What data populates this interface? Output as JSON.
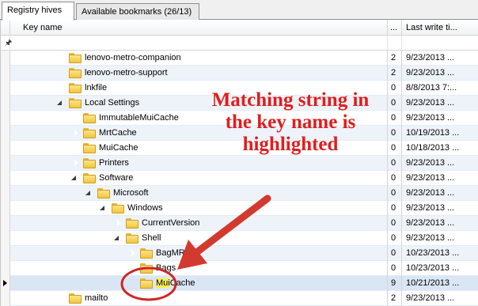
{
  "tabs": [
    {
      "label": "Registry hives",
      "active": true
    },
    {
      "label": "Available bookmarks (26/13)",
      "active": false
    }
  ],
  "columns": {
    "name": "Key name",
    "count": "...",
    "date": "Last write ti..."
  },
  "filter_icon": "pin-icon",
  "rows": [
    {
      "indent": 4,
      "expander": "none",
      "name": "lenovo-metro-companion",
      "count": "2",
      "date": "9/23/2013 ..."
    },
    {
      "indent": 4,
      "expander": "none",
      "name": "lenovo-metro-support",
      "count": "2",
      "date": "9/23/2013 ..."
    },
    {
      "indent": 4,
      "expander": "closed",
      "name": "lnkfile",
      "count": "0",
      "date": "8/8/2013 7:..."
    },
    {
      "indent": 4,
      "expander": "open",
      "name": "Local Settings",
      "count": "0",
      "date": "9/23/2013 ..."
    },
    {
      "indent": 5,
      "expander": "closed",
      "name": "ImmutableMuiCache",
      "count": "0",
      "date": "9/23/2013 ..."
    },
    {
      "indent": 5,
      "expander": "closed",
      "name": "MrtCache",
      "count": "0",
      "date": "10/19/2013 ..."
    },
    {
      "indent": 5,
      "expander": "closed",
      "name": "MuiCache",
      "count": "0",
      "date": "10/18/2013 ..."
    },
    {
      "indent": 5,
      "expander": "closed",
      "name": "Printers",
      "count": "0",
      "date": "9/23/2013 ..."
    },
    {
      "indent": 5,
      "expander": "open",
      "name": "Software",
      "count": "0",
      "date": "9/23/2013 ..."
    },
    {
      "indent": 6,
      "expander": "open",
      "name": "Microsoft",
      "count": "0",
      "date": "9/23/2013 ..."
    },
    {
      "indent": 7,
      "expander": "open",
      "name": "Windows",
      "count": "0",
      "date": "9/23/2013 ..."
    },
    {
      "indent": 8,
      "expander": "closed",
      "name": "CurrentVersion",
      "count": "0",
      "date": "9/23/2013 ..."
    },
    {
      "indent": 8,
      "expander": "open",
      "name": "Shell",
      "count": "0",
      "date": "9/23/2013 ..."
    },
    {
      "indent": 9,
      "expander": "closed",
      "name": "BagMRU",
      "count": "0",
      "date": "10/23/2013 ..."
    },
    {
      "indent": 9,
      "expander": "closed",
      "name": "Bags",
      "count": "0",
      "date": "10/23/2013 ..."
    },
    {
      "indent": 9,
      "expander": "none",
      "name": "MuiCache",
      "count": "9",
      "date": "10/21/2013 ...",
      "selected": true,
      "highlight": "Mui"
    },
    {
      "indent": 4,
      "expander": "none",
      "name": "mailto",
      "count": "2",
      "date": "9/23/2013 ..."
    }
  ],
  "annotation": {
    "text": "Matching string in the key name is highlighted",
    "color": "#e11d1d"
  },
  "colors": {
    "highlight": "#fff05a",
    "selected_row": "#dbe6f4",
    "alt_row": "#eef3f9"
  }
}
